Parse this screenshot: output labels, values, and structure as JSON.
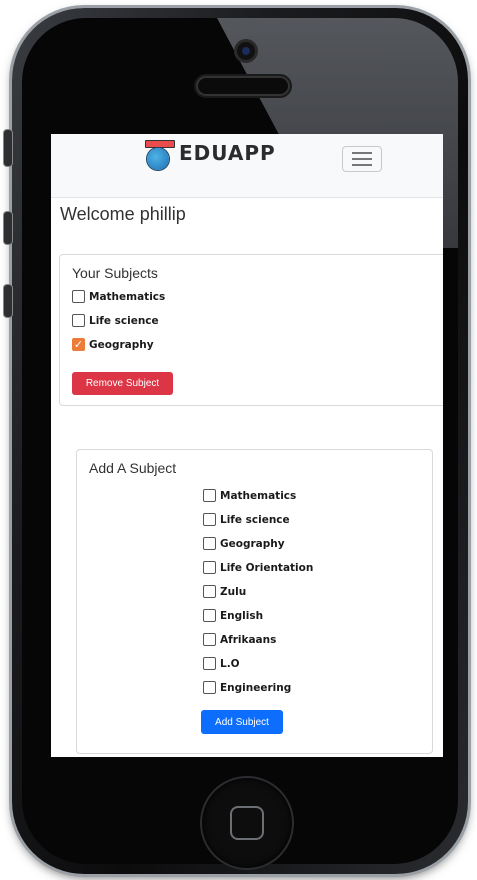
{
  "app": {
    "brand": "EDUAPP",
    "logo_icon": "globe-pencil-icon",
    "menu_icon": "hamburger-menu-icon"
  },
  "welcome": "Welcome phillip",
  "your_subjects": {
    "title": "Your Subjects",
    "items": [
      {
        "label": "Mathematics",
        "checked": false
      },
      {
        "label": "Life science",
        "checked": false
      },
      {
        "label": "Geography",
        "checked": true
      }
    ],
    "remove_button": "Remove Subject"
  },
  "add_subject": {
    "title": "Add A Subject",
    "items": [
      {
        "label": "Mathematics"
      },
      {
        "label": "Life science"
      },
      {
        "label": "Geography"
      },
      {
        "label": "Life Orientation"
      },
      {
        "label": "Zulu"
      },
      {
        "label": "English"
      },
      {
        "label": "Afrikaans"
      },
      {
        "label": "L.O"
      },
      {
        "label": "Engineering"
      }
    ],
    "add_button": "Add Subject"
  },
  "colors": {
    "danger": "#dc3545",
    "primary": "#0d6efd",
    "checked": "#ee7c39"
  }
}
